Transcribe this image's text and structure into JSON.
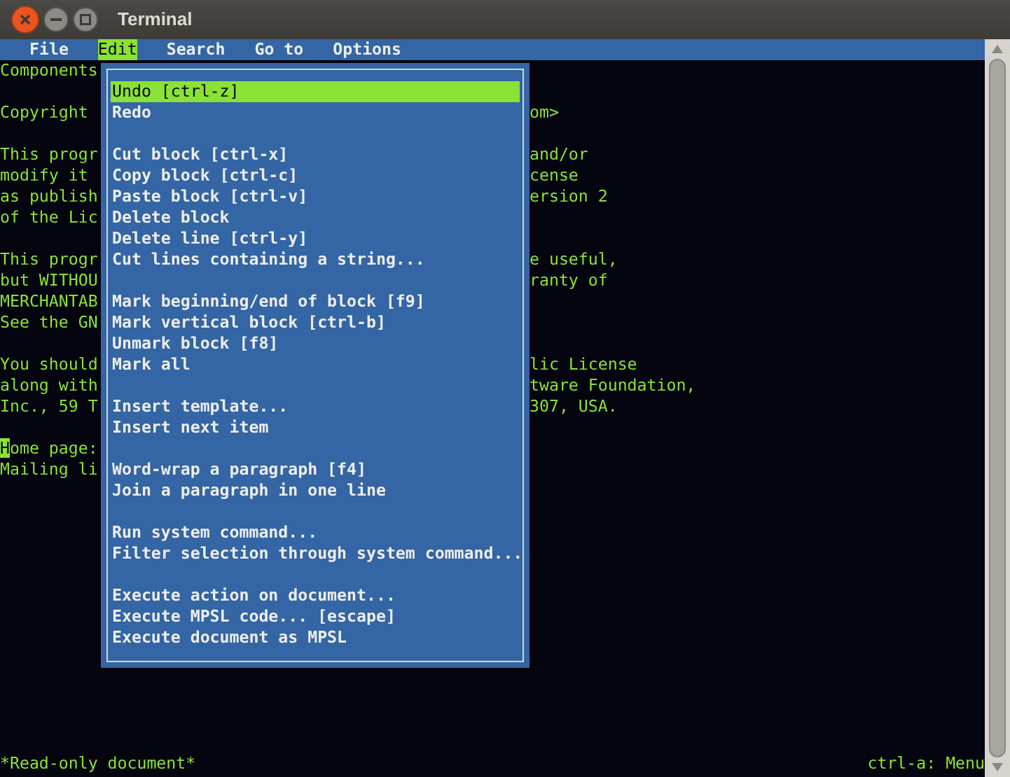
{
  "window": {
    "title": "Terminal"
  },
  "menubar": [
    {
      "label": "File",
      "selected": false
    },
    {
      "label": "Edit",
      "selected": true
    },
    {
      "label": "Search",
      "selected": false
    },
    {
      "label": "Go to",
      "selected": false
    },
    {
      "label": "Options",
      "selected": false
    }
  ],
  "lines": [
    {
      "left": "Components",
      "cursor": false
    },
    {
      "cursor": false
    },
    {
      "left": "Copyright",
      "right": "om>",
      "cursor": false
    },
    {
      "cursor": false
    },
    {
      "left": "This progr",
      "right": "and/or",
      "cursor": false
    },
    {
      "left": "modify it",
      "right": "cense",
      "cursor": false
    },
    {
      "left": "as publish",
      "right": "ersion 2",
      "cursor": false
    },
    {
      "left": "of the Lic",
      "cursor": false
    },
    {
      "cursor": false
    },
    {
      "left": "This progr",
      "right": "e useful,",
      "cursor": false
    },
    {
      "left": "but WITHOU",
      "right": "ranty of",
      "cursor": false
    },
    {
      "left": "MERCHANTAB",
      "cursor": false
    },
    {
      "left": "See the GN",
      "cursor": false
    },
    {
      "cursor": false
    },
    {
      "left": "You should",
      "right": "lic License",
      "cursor": false
    },
    {
      "left": "along with",
      "right": "tware Foundation,",
      "cursor": false
    },
    {
      "left": "Inc., 59 T",
      "right": "307, USA.",
      "cursor": false
    },
    {
      "cursor": false
    },
    {
      "left": "Home page:",
      "cursor": true
    },
    {
      "left": "Mailing li",
      "cursor": false
    }
  ],
  "menu": [
    [
      {
        "label": "Undo [ctrl-z]",
        "selected": true
      },
      {
        "label": "Redo",
        "selected": false
      }
    ],
    [
      {
        "label": "Cut block [ctrl-x]",
        "selected": false
      },
      {
        "label": "Copy block [ctrl-c]",
        "selected": false
      },
      {
        "label": "Paste block [ctrl-v]",
        "selected": false
      },
      {
        "label": "Delete block",
        "selected": false
      },
      {
        "label": "Delete line [ctrl-y]",
        "selected": false
      },
      {
        "label": "Cut lines containing a string...",
        "selected": false
      }
    ],
    [
      {
        "label": "Mark beginning/end of block [f9]",
        "selected": false
      },
      {
        "label": "Mark vertical block [ctrl-b]",
        "selected": false
      },
      {
        "label": "Unmark block [f8]",
        "selected": false
      },
      {
        "label": "Mark all",
        "selected": false
      }
    ],
    [
      {
        "label": "Insert template...",
        "selected": false
      },
      {
        "label": "Insert next item",
        "selected": false
      }
    ],
    [
      {
        "label": "Word-wrap a paragraph [f4]",
        "selected": false
      },
      {
        "label": "Join a paragraph in one line",
        "selected": false
      }
    ],
    [
      {
        "label": "Run system command...",
        "selected": false
      },
      {
        "label": "Filter selection through system command...",
        "selected": false
      }
    ],
    [
      {
        "label": "Execute action on document...",
        "selected": false
      },
      {
        "label": "Execute MPSL code... [escape]",
        "selected": false
      },
      {
        "label": "Execute document as MPSL",
        "selected": false
      }
    ]
  ],
  "status_bar": {
    "left": "*Read-only document*",
    "right": "ctrl-a: Menu"
  }
}
